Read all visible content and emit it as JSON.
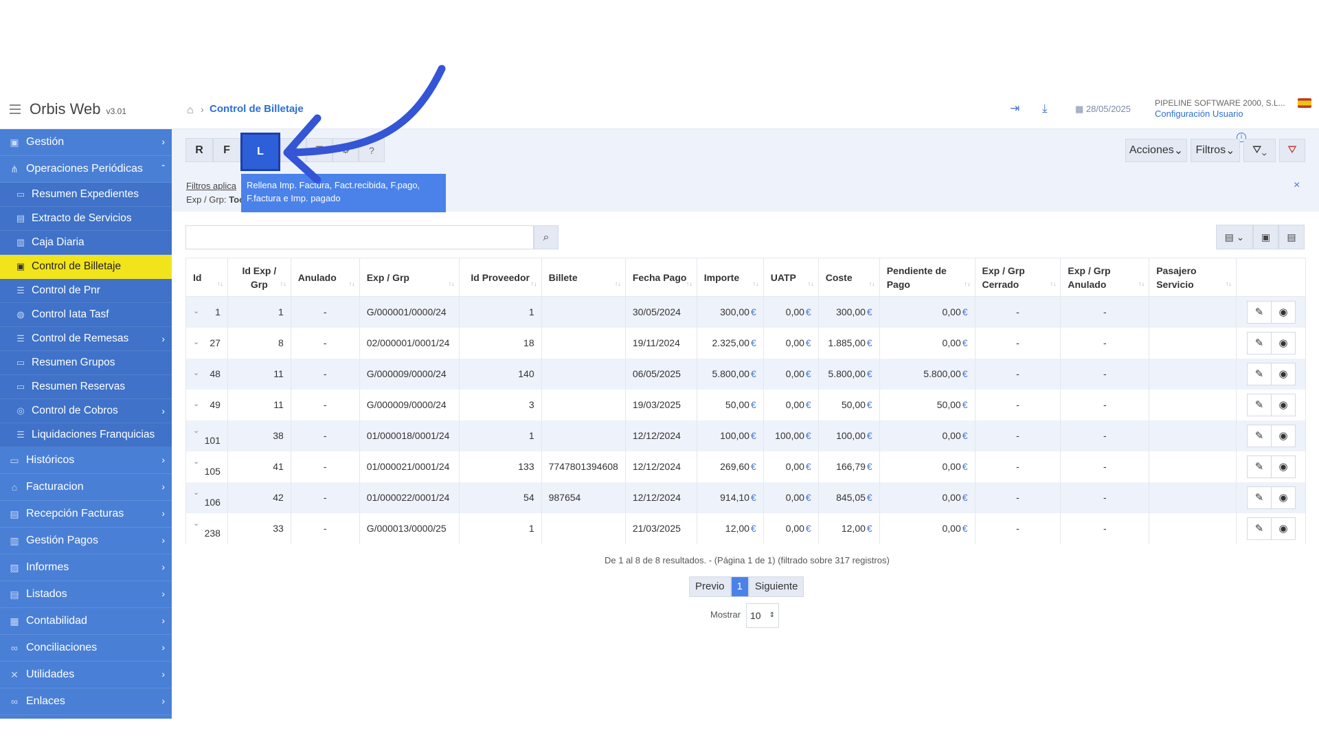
{
  "header": {
    "app_title": "Orbis Web",
    "version": "v3.01",
    "breadcrumb": "Control de Billetaje",
    "date": "28/05/2025",
    "company": "PIPELINE SOFTWARE 2000, S.L...",
    "config_link": "Configuración Usuario"
  },
  "sidebar": {
    "items": [
      {
        "label": "Gestión",
        "icon": "briefcase-icon"
      },
      {
        "label": "Operaciones Periódicas",
        "icon": "hierarchy-icon"
      },
      {
        "label": "Resumen Expedientes",
        "icon": "folders-icon"
      },
      {
        "label": "Extracto de Servicios",
        "icon": "document-icon"
      },
      {
        "label": "Caja Diaria",
        "icon": "register-icon"
      },
      {
        "label": "Control de Billetaje",
        "icon": "ticket-icon"
      },
      {
        "label": "Control de Pnr",
        "icon": "list-icon"
      },
      {
        "label": "Control Iata Tasf",
        "icon": "globe-icon"
      },
      {
        "label": "Control de Remesas",
        "icon": "list-icon"
      },
      {
        "label": "Resumen Grupos",
        "icon": "folders-icon"
      },
      {
        "label": "Resumen Reservas",
        "icon": "folders-icon"
      },
      {
        "label": "Control de Cobros",
        "icon": "coin-icon"
      },
      {
        "label": "Liquidaciones Franquicias",
        "icon": "list-icon"
      },
      {
        "label": "Históricos",
        "icon": "folder-icon"
      },
      {
        "label": "Facturacion",
        "icon": "bank-icon"
      },
      {
        "label": "Recepción Facturas",
        "icon": "invoice-icon"
      },
      {
        "label": "Gestión Pagos",
        "icon": "payment-icon"
      },
      {
        "label": "Informes",
        "icon": "report-icon"
      },
      {
        "label": "Listados",
        "icon": "document-icon"
      },
      {
        "label": "Contabilidad",
        "icon": "ledger-icon"
      },
      {
        "label": "Conciliaciones",
        "icon": "link-icon"
      },
      {
        "label": "Utilidades",
        "icon": "tools-icon"
      },
      {
        "label": "Enlaces",
        "icon": "link-icon"
      }
    ]
  },
  "toolbar": {
    "btn_r": "R",
    "btn_f": "F",
    "btn_l": "L",
    "help": "?",
    "acciones": "Acciones",
    "filtros": "Filtros"
  },
  "tooltip": {
    "line1": "Rellena Imp. Factura, Fact.recibida, F.pago,",
    "line2": "F.factura e Imp. pagado"
  },
  "filters": {
    "label": "Filtros aplica",
    "exp_label": "Exp / Grp:",
    "exp_value": "Too"
  },
  "table": {
    "headers": [
      "Id",
      "Id Exp / Grp",
      "Anulado",
      "Exp / Grp",
      "Id Proveedor",
      "Billete",
      "Fecha Pago",
      "Importe",
      "UATP",
      "Coste",
      "Pendiente de Pago",
      "Exp / Grp Cerrado",
      "Exp / Grp Anulado",
      "Pasajero Servicio"
    ],
    "currency": "€",
    "rows": [
      [
        "1",
        "1",
        "-",
        "G/000001/0000/24",
        "1",
        "",
        "30/05/2024",
        "300,00",
        "0,00",
        "300,00",
        "0,00",
        "-",
        "-",
        ""
      ],
      [
        "27",
        "8",
        "-",
        "02/000001/0001/24",
        "18",
        "",
        "19/11/2024",
        "2.325,00",
        "0,00",
        "1.885,00",
        "0,00",
        "-",
        "-",
        ""
      ],
      [
        "48",
        "11",
        "-",
        "G/000009/0000/24",
        "140",
        "",
        "06/05/2025",
        "5.800,00",
        "0,00",
        "5.800,00",
        "5.800,00",
        "-",
        "-",
        ""
      ],
      [
        "49",
        "11",
        "-",
        "G/000009/0000/24",
        "3",
        "",
        "19/03/2025",
        "50,00",
        "0,00",
        "50,00",
        "50,00",
        "-",
        "-",
        ""
      ],
      [
        "101",
        "38",
        "-",
        "01/000018/0001/24",
        "1",
        "",
        "12/12/2024",
        "100,00",
        "100,00",
        "100,00",
        "0,00",
        "-",
        "-",
        ""
      ],
      [
        "105",
        "41",
        "-",
        "01/000021/0001/24",
        "133",
        "7747801394608",
        "12/12/2024",
        "269,60",
        "0,00",
        "166,79",
        "0,00",
        "-",
        "-",
        ""
      ],
      [
        "106",
        "42",
        "-",
        "01/000022/0001/24",
        "54",
        "987654",
        "12/12/2024",
        "914,10",
        "0,00",
        "845,05",
        "0,00",
        "-",
        "-",
        ""
      ],
      [
        "238",
        "33",
        "-",
        "G/000013/0000/25",
        "1",
        "",
        "21/03/2025",
        "12,00",
        "0,00",
        "12,00",
        "0,00",
        "-",
        "-",
        ""
      ]
    ]
  },
  "footer": {
    "summary": "De 1 al 8 de 8 resultados. - (Página 1 de 1) (filtrado sobre 317 registros)",
    "prev": "Previo",
    "page": "1",
    "next": "Siguiente",
    "show_label": "Mostrar",
    "page_size": "10"
  },
  "colors": {
    "sidebar": "#4a7fd6",
    "active_item": "#f2e41b",
    "accent": "#2a6fd6",
    "annotation_arrow": "#3355d6"
  }
}
